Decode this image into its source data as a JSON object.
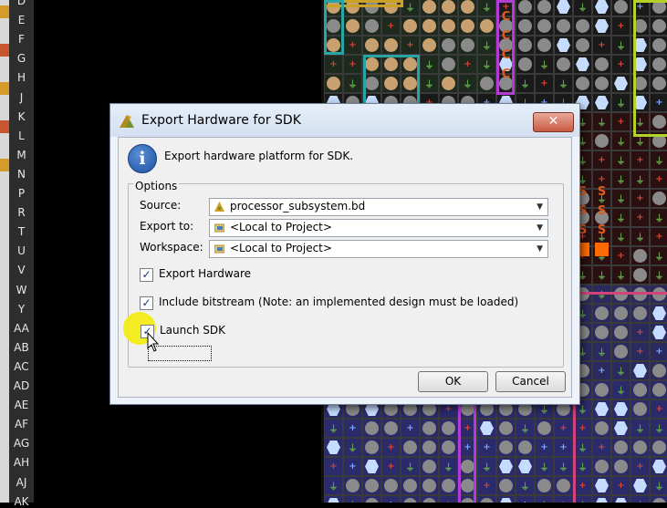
{
  "row_labels": [
    "D",
    "E",
    "F",
    "G",
    "H",
    "J",
    "K",
    "L",
    "M",
    "N",
    "P",
    "R",
    "T",
    "U",
    "V",
    "W",
    "Y",
    "AA",
    "AB",
    "AC",
    "AD",
    "AE",
    "AF",
    "AG",
    "AH",
    "AJ",
    "AK"
  ],
  "grid": {
    "cell_symbols": [
      "circle-tan",
      "circle-gray",
      "ground",
      "power-red",
      "hex-blue",
      "power-blue"
    ],
    "region_letters": {
      "c_marker": "C",
      "s_marker": "S"
    }
  },
  "dialog": {
    "title": "Export Hardware for SDK",
    "close_label": "✕",
    "header": "Export hardware platform for SDK.",
    "options_title": "Options",
    "source": {
      "label": "Source:",
      "value": "processor_subsystem.bd"
    },
    "export_to": {
      "label": "Export to:",
      "value": "<Local to Project>"
    },
    "workspace": {
      "label": "Workspace:",
      "value": "<Local to Project>"
    },
    "checkboxes": [
      {
        "label": "Export Hardware",
        "checked": true
      },
      {
        "label": "Include bitstream (Note: an implemented design must be loaded)",
        "checked": true
      },
      {
        "label": "Launch SDK",
        "checked": true
      }
    ],
    "ok_label": "OK",
    "cancel_label": "Cancel"
  },
  "colors": {
    "highlight": "#f2eb16",
    "dialog_bg": "#eef3fa",
    "close_red": "#c75a43"
  }
}
